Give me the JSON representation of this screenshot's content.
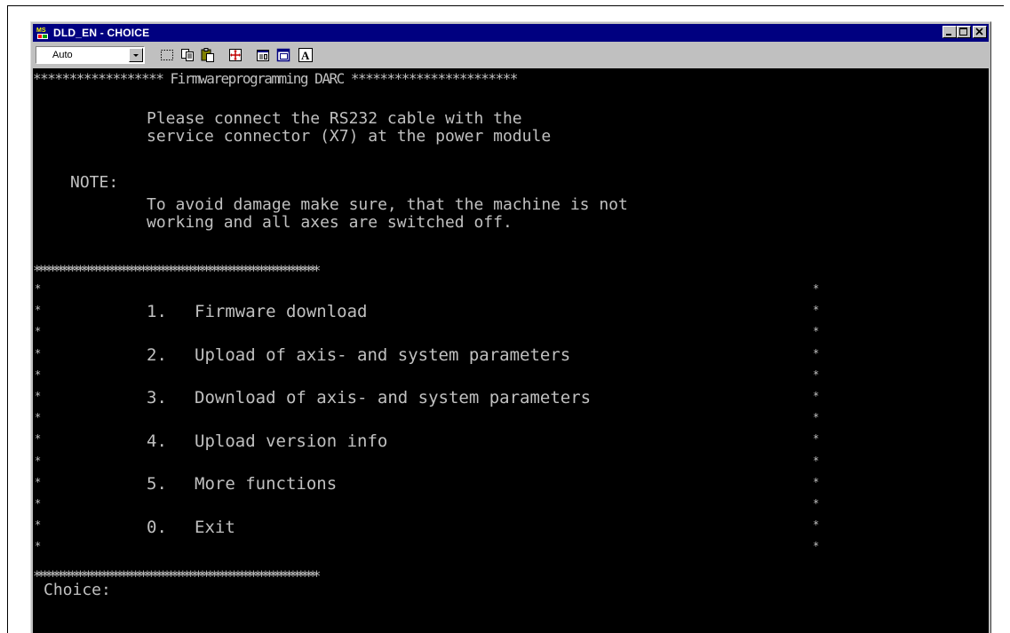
{
  "window": {
    "title": "DLD_EN - CHOICE",
    "app_icon": "ms-dos-icon"
  },
  "title_buttons": [
    {
      "icon": "minimize-icon"
    },
    {
      "icon": "maximize-icon"
    },
    {
      "icon": "close-icon"
    }
  ],
  "toolbar": {
    "font_size_value": "Auto",
    "tools": [
      {
        "icon": "mark-icon"
      },
      {
        "icon": "copy-icon"
      },
      {
        "icon": "paste-icon"
      },
      {
        "icon": "full-screen-icon"
      },
      {
        "icon": "properties-icon"
      },
      {
        "icon": "background-icon"
      },
      {
        "icon": "font-icon"
      }
    ]
  },
  "terminal": {
    "header": "****************** Firmwareprogramming DARC ***********************",
    "intro_line1": "Please connect the RS232 cable with the",
    "intro_line2": "service connector (X7) at the power module",
    "note_label": "NOTE:",
    "note_line1": "To avoid damage make sure, that the machine is not",
    "note_line2": "working and all axes are switched off.",
    "separator": "************************************************************************",
    "menu_items": [
      {
        "number": "1.",
        "label": "Firmware download"
      },
      {
        "number": "2.",
        "label": "Upload of axis- and system parameters"
      },
      {
        "number": "3.",
        "label": "Download of axis- and system parameters"
      },
      {
        "number": "4.",
        "label": "Upload version info"
      },
      {
        "number": "5.",
        "label": "More functions"
      },
      {
        "number": "0.",
        "label": "Exit"
      }
    ],
    "footer_separator": "************************************************************************",
    "prompt": "Choice:"
  },
  "colors": {
    "terminal_bg": "#000000",
    "terminal_fg": "#c0c0c0",
    "titlebar_bg": "#000080",
    "window_face": "#c0c0c0"
  }
}
